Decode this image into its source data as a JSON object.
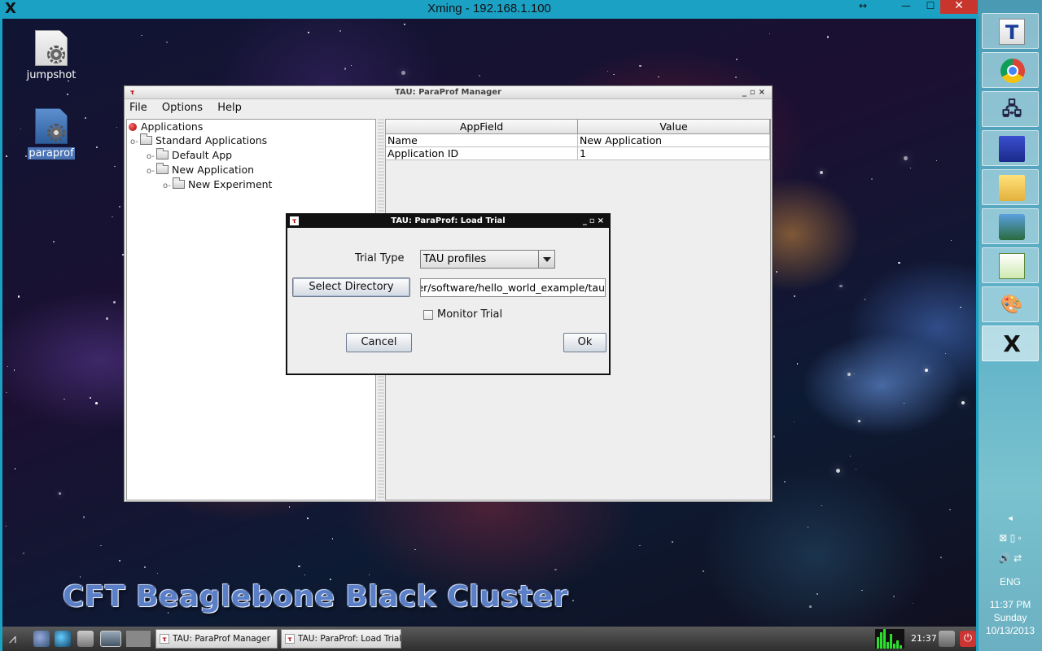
{
  "xming": {
    "title": "Xming - 192.168.1.100",
    "resize_glyph": "↔",
    "minimize_glyph": "—",
    "maximize_glyph": "☐",
    "close_glyph": "✕"
  },
  "desktop": {
    "icons": [
      {
        "label": "jumpshot",
        "icon": "document-gear-icon"
      },
      {
        "label": "paraprof",
        "icon": "document-gear-icon",
        "selected": true
      }
    ],
    "wallpaper_text": "CFT Beaglebone Black Cluster"
  },
  "manager": {
    "title": "TAU: ParaProf Manager",
    "menu": [
      "File",
      "Options",
      "Help"
    ],
    "tree": {
      "root": "Applications",
      "standard": "Standard Applications",
      "default_app": "Default App",
      "new_application": "New Application",
      "new_experiment": "New Experiment"
    },
    "table": {
      "headers": [
        "AppField",
        "Value"
      ],
      "rows": [
        [
          "Name",
          "New Application"
        ],
        [
          "Application ID",
          "1"
        ]
      ]
    }
  },
  "dialog": {
    "title": "TAU: ParaProf: Load Trial",
    "trial_type_label": "Trial Type",
    "trial_type_value": "TAU profiles",
    "select_directory_label": "Select Directory",
    "path_value": "er/software/hello_world_example/tau",
    "monitor_trial_label": "Monitor Trial",
    "monitor_trial_checked": false,
    "cancel_label": "Cancel",
    "ok_label": "Ok"
  },
  "bottom_taskbar": {
    "tasks": [
      "TAU: ParaProf Manager",
      "TAU: ParaProf: Load Trial"
    ],
    "time": "21:37"
  },
  "win_taskbar": {
    "language": "ENG",
    "time": "11:37 PM",
    "day": "Sunday",
    "date": "10/13/2013",
    "apps": [
      "tau-icon",
      "chrome-icon",
      "network-computer-icon",
      "floppy-save-icon",
      "file-explorer-icon",
      "lock-transfer-icon",
      "chart-editor-icon",
      "paint-palette-icon",
      "xming-icon"
    ]
  },
  "colors": {
    "win8_accent": "#1ba1c4",
    "close_red": "#c7352d",
    "wallpaper_text": "#5b7fc7"
  }
}
